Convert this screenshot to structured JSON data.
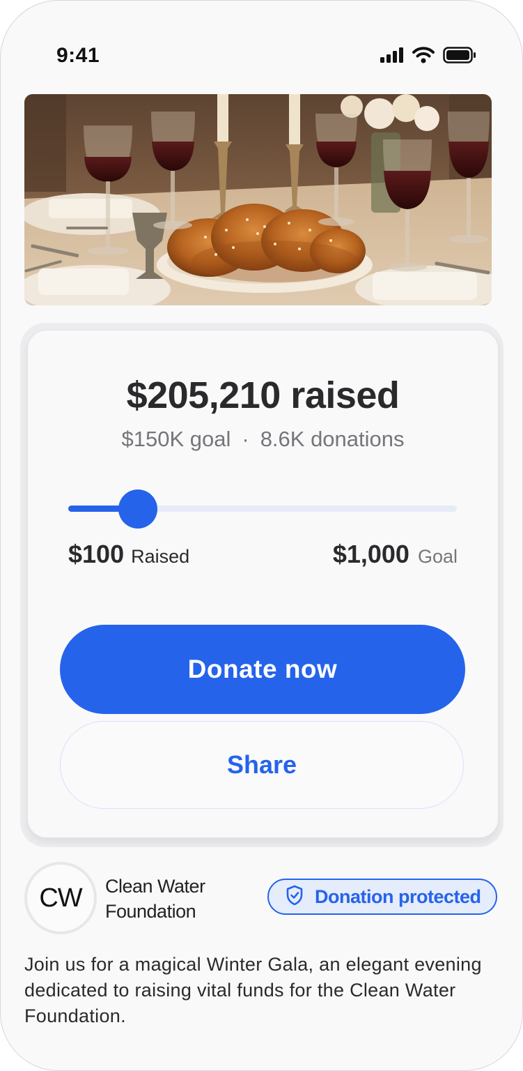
{
  "status_bar": {
    "time": "9:41"
  },
  "hero": {
    "icon": "sabbath-dinner-photo"
  },
  "campaign": {
    "amount_raised": "$205,210 raised",
    "goal": "$150K goal",
    "separator": "·",
    "donations": "8.6K donations"
  },
  "slider": {
    "level": 0.18,
    "min_value": "$100",
    "min_label": "Raised",
    "max_value": "$1,000",
    "max_label": "Goal"
  },
  "actions": {
    "donate_label": "Donate now",
    "share_label": "Share"
  },
  "organizer": {
    "initials": "CW",
    "name": "Clean Water Foundation"
  },
  "badge": {
    "label": "Donation protected",
    "icon": "shield-check-icon"
  },
  "description": "Join us for a magical Winter Gala, an elegant evening dedicated to raising vital funds for the Clean Water Foundation.",
  "colors": {
    "accent": "#2563eb",
    "accent_light": "#e5ecfb",
    "text_primary": "#2a2a2d",
    "text_secondary": "#75757a"
  }
}
